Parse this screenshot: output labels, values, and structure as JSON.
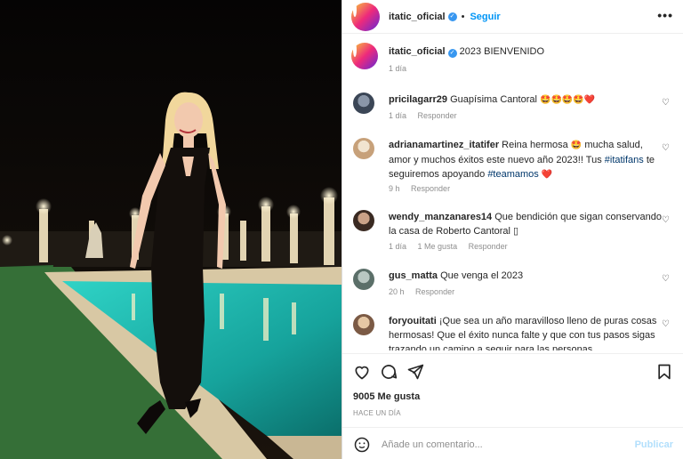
{
  "post": {
    "username": "itatic_oficial",
    "follow_label": "Seguir",
    "separator": "•",
    "more_label": "•••"
  },
  "caption": {
    "username": "itatic_oficial",
    "text": "2023 BIENVENIDO",
    "time": "1 día"
  },
  "comments": [
    {
      "username": "pricilagarr29",
      "text": "Guapísima Cantoral",
      "emoji": "🤩🤩🤩🤩❤️",
      "time": "1 día",
      "reply": "Responder"
    },
    {
      "username": "adrianamartinez_itatifer",
      "text": "Reina hermosa",
      "emoji1": "🤩",
      "text2": "mucha salud, amor y muchos éxitos este nuevo año 2023!! Tus",
      "tag1": "#itatifans",
      "text3": "te seguiremos apoyando",
      "tag2": "#teamamos",
      "emoji2": "❤️",
      "time": "9 h",
      "reply": "Responder"
    },
    {
      "username": "wendy_manzanares14",
      "text": "Que bendición que sigan conservando la casa de Roberto Cantoral ▯",
      "time": "1 día",
      "likes": "1 Me gusta",
      "reply": "Responder"
    },
    {
      "username": "gus_matta",
      "text": "Que venga el 2023",
      "time": "20 h",
      "reply": "Responder"
    },
    {
      "username": "foryouitati",
      "text": "¡Que sea un año maravilloso lleno de puras cosas hermosas! Que el éxito nunca falte y que con tus pasos sigas trazando un camino a seguir para las personas"
    }
  ],
  "footer": {
    "likes": "9005 Me gusta",
    "when": "HACE UN DÍA",
    "comment_placeholder": "Añade un comentario...",
    "publish_label": "Publicar"
  },
  "icons": {
    "heart": "heart-icon",
    "comment": "comment-icon",
    "share": "share-icon",
    "save": "bookmark-icon",
    "emoji": "smiley-icon"
  },
  "colors": {
    "link_blue": "#0095f6",
    "publish_disabled": "#b2dffc",
    "muted": "#8e8e8e",
    "pool": "#1fb6b0"
  }
}
